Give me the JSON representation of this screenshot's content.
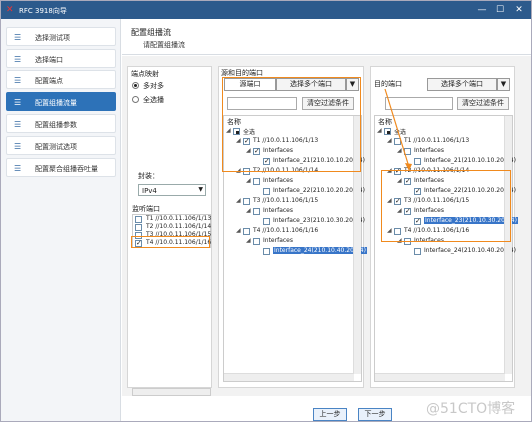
{
  "window": {
    "title": "RFC 3918向导",
    "buttons": [
      "—",
      "☐",
      "✕"
    ]
  },
  "sidebar": {
    "items": [
      {
        "label": "选择测试项",
        "active": false
      },
      {
        "label": "选择端口",
        "active": false
      },
      {
        "label": "配置端点",
        "active": false
      },
      {
        "label": "配置组播流量",
        "active": true
      },
      {
        "label": "配置组播参数",
        "active": false
      },
      {
        "label": "配置测试选项",
        "active": false
      },
      {
        "label": "配置聚合组播吞吐量",
        "active": false
      }
    ]
  },
  "header": {
    "title": "配置组播流",
    "subtitle": "请配置组播流"
  },
  "endpoint": {
    "group_label": "端点映射",
    "radio_options": [
      {
        "label": "多对多",
        "checked": true
      },
      {
        "label": "全选播",
        "checked": false
      }
    ],
    "encap_label": "封装：",
    "encap_value": "IPv4",
    "listen_label": "监听端口",
    "ports": [
      {
        "label": "T1 //10.0.11.106/1/13",
        "checked": false
      },
      {
        "label": "T2 //10.0.11.106/1/14",
        "checked": false
      },
      {
        "label": "T3 //10.0.11.106/1/15",
        "checked": false
      },
      {
        "label": "T4 //10.0.11.106/1/16",
        "checked": true
      }
    ]
  },
  "source": {
    "title": "源和目的端口",
    "tab_left": "源端口",
    "tab_right": "选择多个端口",
    "search_placeholder": "",
    "filter_button": "清空过滤条件",
    "tree_header": "名称",
    "tree": {
      "root": "全选",
      "t1": "T1 //10.0.11.106/1/13",
      "t1_if": "Interfaces",
      "t1_leaf": "Interface_21(210.10.10.20/24)",
      "t2": "T2 //10.0.11.106/1/14",
      "t2_if": "Interfaces",
      "t2_leaf": "Interface_22(210.10.20.20/24)",
      "t3": "T3 //10.0.11.106/1/15",
      "t3_if": "Interfaces",
      "t3_leaf": "Interface_23(210.10.30.20/24)",
      "t4": "T4 //10.0.11.106/1/16",
      "t4_if": "Interfaces",
      "t4_leaf": "Interface_24(210.10.40.20/24)"
    }
  },
  "dest": {
    "tab_left": "目的端口",
    "tab_right": "选择多个端口",
    "search_placeholder": "",
    "filter_button": "清空过滤条件",
    "tree_header": "名称",
    "tree": {
      "root": "全选",
      "t1": "T1 //10.0.11.106/1/13",
      "t1_if": "Interfaces",
      "t1_leaf": "Interface_21(210.10.10.20/24)",
      "t2": "T2 //10.0.11.106/1/14",
      "t2_if": "Interfaces",
      "t2_leaf": "Interface_22(210.10.20.20/24)",
      "t3": "T3 //10.0.11.106/1/15",
      "t3_if": "Interfaces",
      "t3_leaf": "Interface_23(210.10.30.20/24)",
      "t4": "T4 //10.0.11.106/1/16",
      "t4_if": "Interfaces",
      "t4_leaf": "Interface_24(210.10.40.20/24)"
    }
  },
  "footer": {
    "prev": "上一步",
    "next": "下一步"
  },
  "watermark": "@51CTO博客",
  "colors": {
    "titlebar": "#2c5a8c",
    "active": "#2d72b8",
    "highlight_box": "#f08a1e",
    "selection": "#3875c8"
  }
}
